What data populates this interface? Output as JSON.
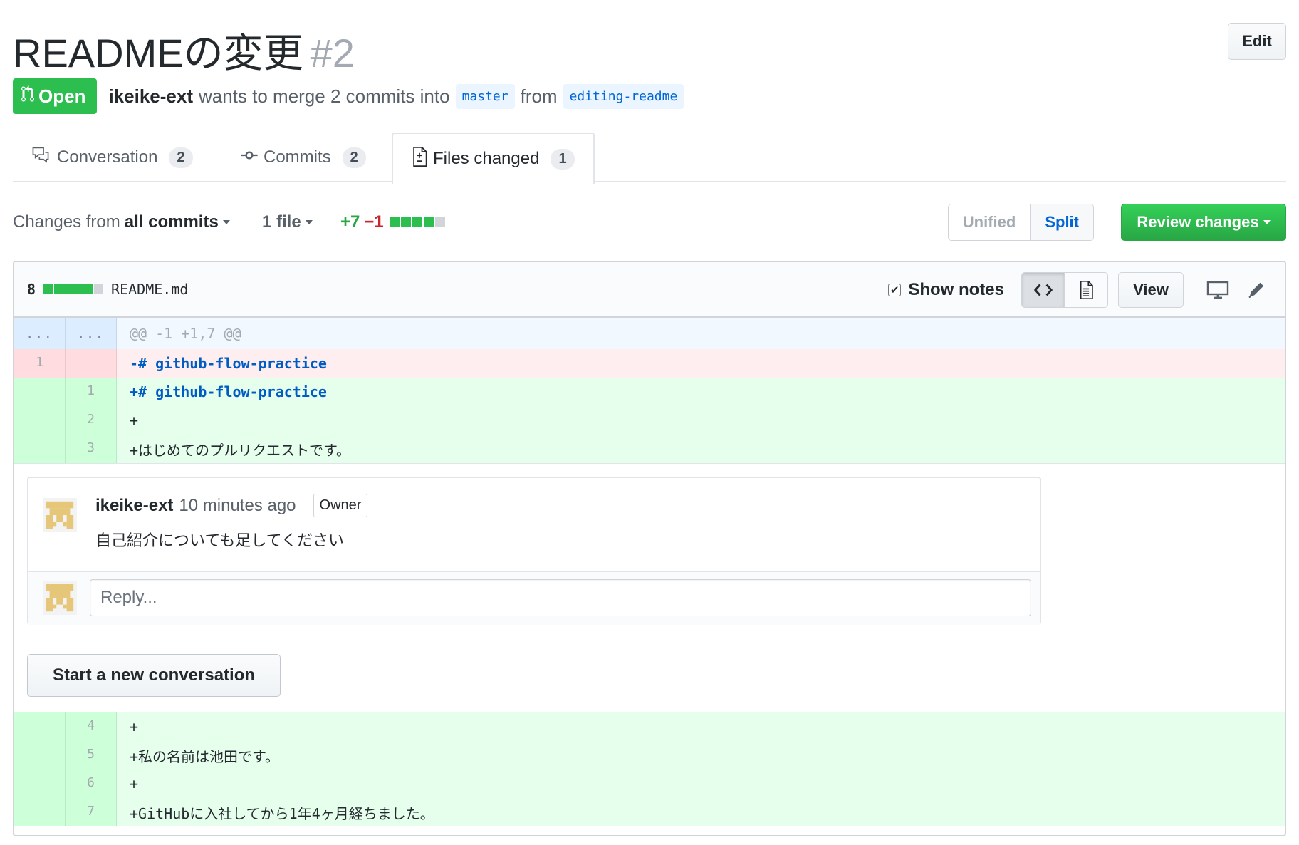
{
  "pr": {
    "title": "READMEの変更",
    "number": "#2",
    "edit_label": "Edit",
    "state": "Open",
    "author": "ikeike-ext",
    "merge_text": "wants to merge 2 commits into",
    "base_branch": "master",
    "from_text": "from",
    "head_branch": "editing-readme"
  },
  "tabs": [
    {
      "label": "Conversation",
      "count": "2",
      "icon": "comment-discussion-icon"
    },
    {
      "label": "Commits",
      "count": "2",
      "icon": "git-commit-icon"
    },
    {
      "label": "Files changed",
      "count": "1",
      "icon": "file-diff-icon",
      "active": true
    }
  ],
  "toolbar": {
    "changes_prefix": "Changes from",
    "changes_value": "all commits",
    "file_filter": "1 file",
    "additions": "+7",
    "deletions": "−1",
    "unified_label": "Unified",
    "split_label": "Split",
    "review_label": "Review changes"
  },
  "file": {
    "change_count": "8",
    "name": "README.md",
    "show_notes_label": "Show notes",
    "view_label": "View",
    "hunk_header": "@@ -1 +1,7 @@",
    "hunk_left": "...",
    "hunk_right": "..."
  },
  "lines_before": [
    {
      "type": "del",
      "old": "1",
      "new": "",
      "text": "-# github-flow-practice"
    },
    {
      "type": "add",
      "old": "",
      "new": "1",
      "text": "+# github-flow-practice"
    },
    {
      "type": "add",
      "old": "",
      "new": "2",
      "text": "+"
    },
    {
      "type": "add",
      "old": "",
      "new": "3",
      "text": "+はじめてのプルリクエストです。"
    }
  ],
  "comment": {
    "author": "ikeike-ext",
    "time": "10 minutes ago",
    "role": "Owner",
    "body": "自己紹介についても足してください",
    "reply_placeholder": "Reply..."
  },
  "new_conversation_label": "Start a new conversation",
  "lines_after": [
    {
      "type": "add",
      "old": "",
      "new": "4",
      "text": "+"
    },
    {
      "type": "add",
      "old": "",
      "new": "5",
      "text": "+私の名前は池田です。"
    },
    {
      "type": "add",
      "old": "",
      "new": "6",
      "text": "+"
    },
    {
      "type": "add",
      "old": "",
      "new": "7",
      "text": "+GitHubに入社してから1年4ヶ月経ちました。"
    }
  ],
  "colors": {
    "open_green": "#2cbe4e",
    "add_bg": "#e6ffed",
    "del_bg": "#ffeef0",
    "link_blue": "#0366d6"
  }
}
